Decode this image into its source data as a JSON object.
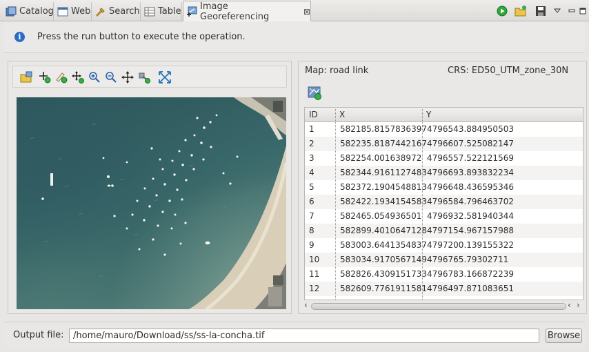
{
  "tabs": [
    {
      "label": "Catalog",
      "icon": "catalog-icon"
    },
    {
      "label": "Web",
      "icon": "web-icon"
    },
    {
      "label": "Search",
      "icon": "search-icon"
    },
    {
      "label": "Table",
      "icon": "table-icon"
    },
    {
      "label": "Image Georeferencing",
      "icon": "georeferencing-icon",
      "active": true,
      "close": "⊠"
    }
  ],
  "toolbar": {
    "run": "run-icon",
    "open": "open-folder-icon",
    "save": "save-icon",
    "menu": "view-menu-icon",
    "minimize": "minimize-icon",
    "maximize": "maximize-icon"
  },
  "message": {
    "icon": "info-icon",
    "text": "Press the run button to execute the operation."
  },
  "map_tools": [
    "open-image-icon",
    "add-point-icon",
    "edit-point-icon",
    "move-point-icon",
    "zoom-in-icon",
    "zoom-out-icon",
    "pan-icon",
    "select-point-icon",
    "zoom-extent-icon"
  ],
  "right": {
    "map_label": "Map: road link",
    "crs_label": "CRS: ED50_UTM_zone_30N",
    "add_icon": "add-control-point-icon"
  },
  "table": {
    "columns": [
      "ID",
      "X",
      "Y"
    ],
    "rows": [
      [
        "1",
        "582185.8157836397",
        "4796543.884950503"
      ],
      [
        "2",
        "582235.8187442167",
        "4796607.525082147"
      ],
      [
        "3",
        "582254.001638972",
        "4796557.522121569"
      ],
      [
        "4",
        "582344.9161127483",
        "4796693.893832234"
      ],
      [
        "5",
        "582372.1904548813",
        "4796648.436595346"
      ],
      [
        "6",
        "582422.1934154583",
        "4796584.796463702"
      ],
      [
        "7",
        "582465.054936501",
        "4796932.581940344"
      ],
      [
        "8",
        "582899.4010647128",
        "4797154.967157988"
      ],
      [
        "9",
        "583003.6441354837",
        "4797200.139155322"
      ],
      [
        "10",
        "583034.9170567149",
        "4796765.79302711"
      ],
      [
        "11",
        "582826.4309151733",
        "4796783.166872239"
      ],
      [
        "12",
        "582609.7761911581",
        "4796497.871083651"
      ]
    ]
  },
  "output": {
    "label": "Output file:",
    "value": "/home/mauro/Download/ss/ss-la-concha.tif",
    "browse": "Browse"
  },
  "colors": {
    "accent": "#2c6cc4",
    "run_green": "#2fa83a",
    "water": "#39686a",
    "sand": "#d8cdb3"
  }
}
